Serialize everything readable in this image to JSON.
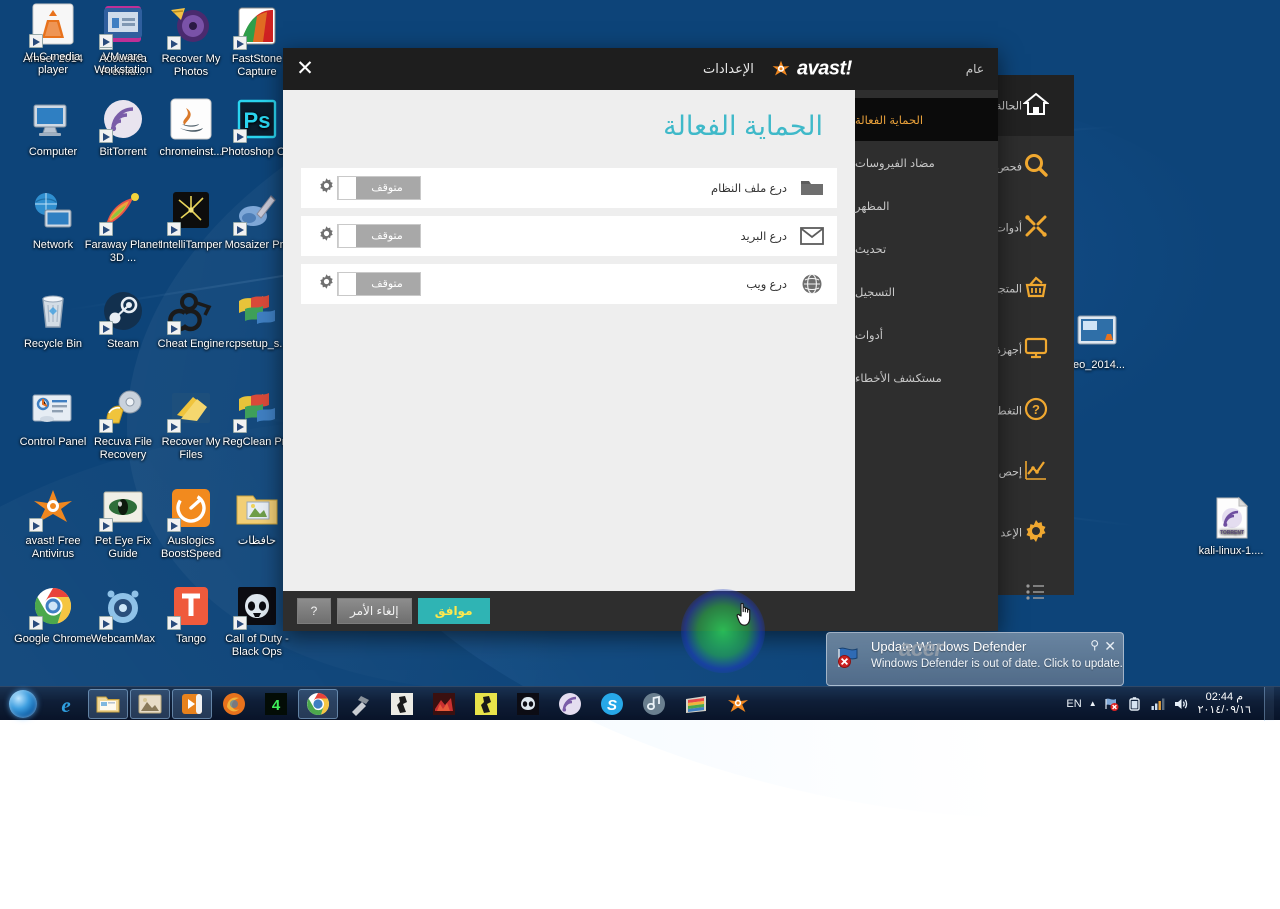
{
  "desktop": {
    "icons_left": [
      {
        "label": "Ameer 2014",
        "kind": "folder-user",
        "shortcut": false
      },
      {
        "label": "Acoustica Premiu...",
        "kind": "acoustica",
        "shortcut": true
      },
      {
        "label": "Recover My Photos",
        "kind": "recover-photos",
        "shortcut": true
      },
      {
        "label": "FastStone Capture",
        "kind": "faststone",
        "shortcut": true
      },
      {
        "label": "Computer",
        "kind": "computer",
        "shortcut": false
      },
      {
        "label": "BitTorrent",
        "kind": "bittorrent",
        "shortcut": true
      },
      {
        "label": "chromeinst...",
        "kind": "java",
        "shortcut": false
      },
      {
        "label": "Photoshop CC",
        "kind": "photoshop",
        "shortcut": true
      },
      {
        "label": "Network",
        "kind": "network",
        "shortcut": false
      },
      {
        "label": "Faraway Planet 3D ...",
        "kind": "faraway",
        "shortcut": true
      },
      {
        "label": "IntelliTamper",
        "kind": "intellitamper",
        "shortcut": true
      },
      {
        "label": "Mosaizer Pro",
        "kind": "mosaizer",
        "shortcut": true
      },
      {
        "label": "Recycle Bin",
        "kind": "recyclebin",
        "shortcut": false
      },
      {
        "label": "Steam",
        "kind": "steam",
        "shortcut": true
      },
      {
        "label": "Cheat Engine",
        "kind": "cheatengine",
        "shortcut": true
      },
      {
        "label": "rcpsetup_s...",
        "kind": "winflag",
        "shortcut": false
      },
      {
        "label": "Control Panel",
        "kind": "controlpanel",
        "shortcut": false
      },
      {
        "label": "Recuva File Recovery",
        "kind": "recuva",
        "shortcut": true
      },
      {
        "label": "Recover My Files",
        "kind": "recoverfiles",
        "shortcut": true
      },
      {
        "label": "RegClean Pro",
        "kind": "regclean",
        "shortcut": true
      },
      {
        "label": "avast! Free Antivirus",
        "kind": "avast",
        "shortcut": true
      },
      {
        "label": "Pet Eye Fix Guide",
        "kind": "peteye",
        "shortcut": true
      },
      {
        "label": "Auslogics BoostSpeed",
        "kind": "auslogics",
        "shortcut": true
      },
      {
        "label": "حافظات",
        "kind": "folder-pics",
        "shortcut": false
      },
      {
        "label": "Google Chrome",
        "kind": "chrome",
        "shortcut": true
      },
      {
        "label": "WebcamMax",
        "kind": "webcammax",
        "shortcut": true
      },
      {
        "label": "Tango",
        "kind": "tango",
        "shortcut": true
      },
      {
        "label": "Call of Duty - Black Ops",
        "kind": "cod",
        "shortcut": true
      },
      {
        "label": "VLC media player",
        "kind": "vlc",
        "shortcut": true
      },
      {
        "label": "VMware Workstation",
        "kind": "vmware",
        "shortcut": true
      }
    ],
    "icons_right": [
      {
        "label": "eo_2014...",
        "kind": "videofile"
      },
      {
        "label": "kali-linux-1....",
        "kind": "torrentfile"
      }
    ]
  },
  "avast_rail": {
    "items": [
      {
        "label": "الحالة",
        "icon": "home-icon",
        "active": true
      },
      {
        "label": "فحص",
        "icon": "search-icon",
        "active": false
      },
      {
        "label": "أدوات",
        "icon": "tools-icon",
        "active": false
      },
      {
        "label": "المتجر",
        "icon": "store-icon",
        "active": false
      },
      {
        "label": "أجهزة",
        "icon": "monitor-icon",
        "active": false
      },
      {
        "label": "التغطي",
        "icon": "help-icon",
        "active": false
      },
      {
        "label": "إحص",
        "icon": "stats-icon",
        "active": false
      },
      {
        "label": "الإعد",
        "icon": "gear-icon",
        "active": false
      },
      {
        "label": "",
        "icon": "menu-icon",
        "active": false
      }
    ]
  },
  "dialog": {
    "close_label": "✕",
    "settings_label": "الإعدادات",
    "brand": "avast!",
    "general_label": "عام",
    "title": "الحماية الفعالة",
    "nav": [
      {
        "label": "الحماية الفعالة",
        "active": true
      },
      {
        "label": "مضاد الفيروسات",
        "active": false
      },
      {
        "label": "المظهر",
        "active": false
      },
      {
        "label": "تحديث",
        "active": false
      },
      {
        "label": "التسجيل",
        "active": false
      },
      {
        "label": "أدوات",
        "active": false
      },
      {
        "label": "مستكشف الأخطاء",
        "active": false
      }
    ],
    "shields": [
      {
        "name": "درع ملف النظام",
        "icon": "folder-icon",
        "state": "متوقف"
      },
      {
        "name": "درع البريد",
        "icon": "envelope-icon",
        "state": "متوقف"
      },
      {
        "name": "درع ويب",
        "icon": "globe-icon",
        "state": "متوقف"
      }
    ],
    "buttons": {
      "help": "?",
      "cancel": "إلغاء الأمر",
      "ok": "موافق"
    },
    "colors": {
      "title": "#3fb9c9",
      "ok_button": "#2fb4b4",
      "ok_text": "#ffe84d",
      "nav_active_text": "#e9a13b",
      "brand_orange": "#f0a830"
    }
  },
  "toast": {
    "title": "Update Windows Defender",
    "body": "Windows Defender is out of date. Click to update.",
    "watermark": "acer",
    "pin": "⚲",
    "close": "✕"
  },
  "taskbar": {
    "items": [
      {
        "name": "internet-explorer",
        "open": false
      },
      {
        "name": "windows-explorer",
        "open": true
      },
      {
        "name": "photo-viewer",
        "open": true
      },
      {
        "name": "media-player",
        "open": true
      },
      {
        "name": "firefox",
        "open": false
      },
      {
        "name": "game-four",
        "open": false
      },
      {
        "name": "google-chrome",
        "open": true
      },
      {
        "name": "hammer-tool",
        "open": false
      },
      {
        "name": "counter-strike",
        "open": false
      },
      {
        "name": "red-game",
        "open": false
      },
      {
        "name": "counter-strike-2",
        "open": false
      },
      {
        "name": "skull-game",
        "open": false
      },
      {
        "name": "bittorrent",
        "open": false
      },
      {
        "name": "skype",
        "open": false
      },
      {
        "name": "music-player",
        "open": false
      },
      {
        "name": "winrar",
        "open": false
      },
      {
        "name": "avast-tray",
        "open": false
      }
    ],
    "tray": {
      "language": "EN",
      "expand": "▲",
      "icons": [
        "action-center-icon",
        "battery-icon",
        "network-icon",
        "volume-icon"
      ]
    },
    "clock": {
      "time": "02:44 م",
      "date": "٢٠١٤/٠٩/١٦"
    }
  }
}
